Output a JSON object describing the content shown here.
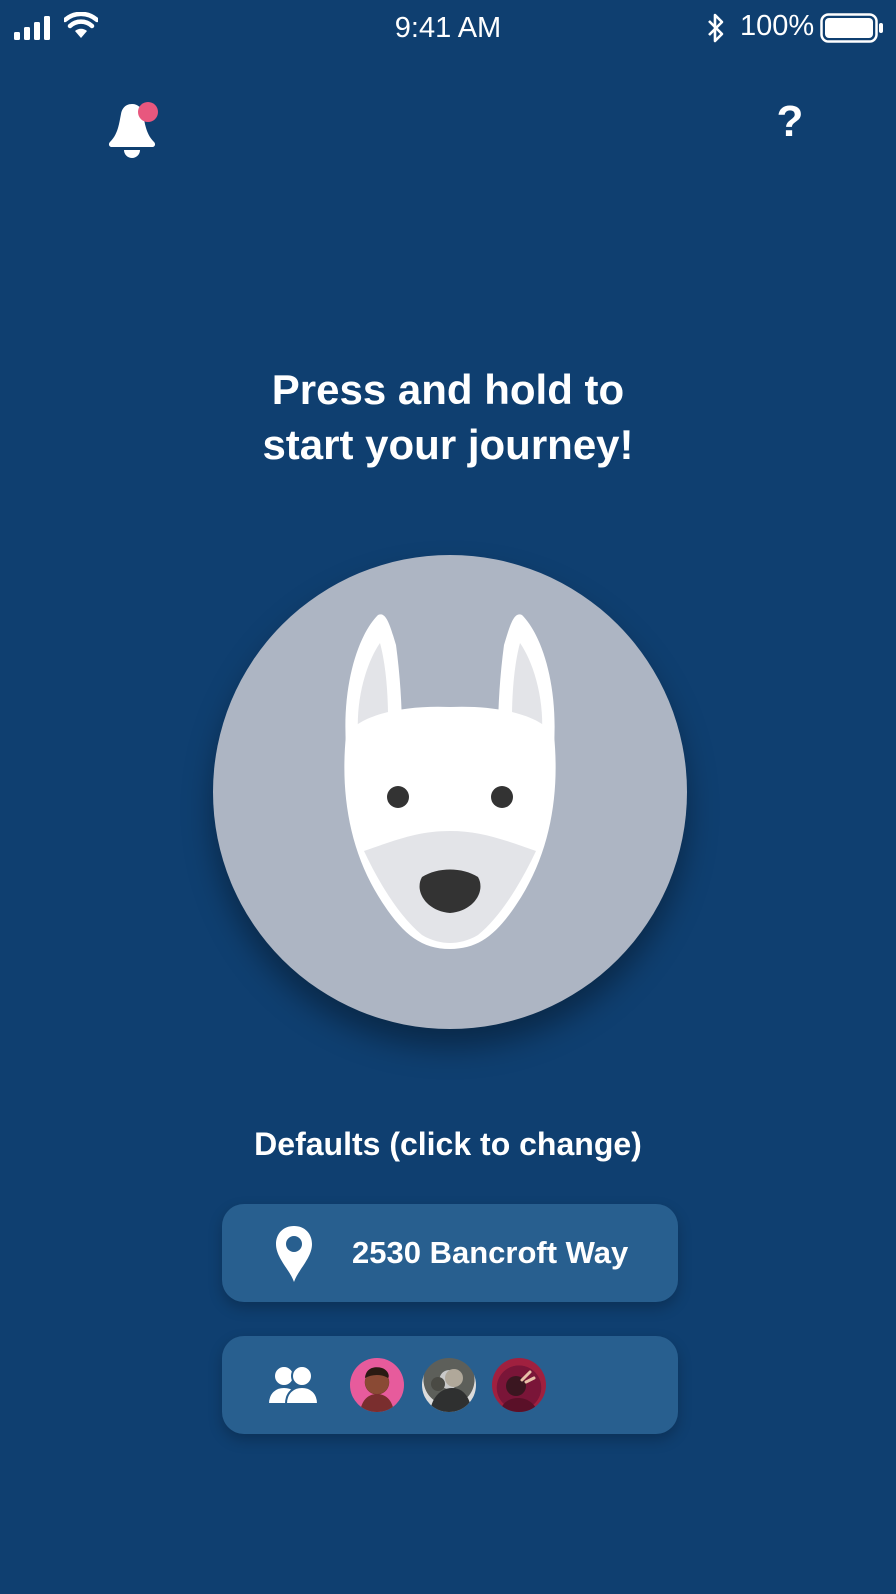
{
  "status_bar": {
    "time": "9:41 AM",
    "battery_percent": "100%",
    "icons": [
      "signal-icon",
      "wifi-icon",
      "bluetooth-icon",
      "battery-icon"
    ]
  },
  "header": {
    "notification_icon": "bell-icon",
    "has_notification": true,
    "help_label": "?"
  },
  "main": {
    "headline_line1": "Press and hold to",
    "headline_line2": "start your journey!",
    "start_button_icon": "dog-icon"
  },
  "defaults": {
    "label": "Defaults (click to change)",
    "location": {
      "icon": "map-pin-icon",
      "address": "2530 Bancroft Way"
    },
    "group": {
      "icon": "group-icon",
      "avatars": [
        "avatar-1",
        "avatar-2",
        "avatar-3"
      ]
    }
  },
  "colors": {
    "background": "#0f3f70",
    "card": "#285f8f",
    "circle": "#adb5c3",
    "notification_dot": "#e8577e"
  }
}
